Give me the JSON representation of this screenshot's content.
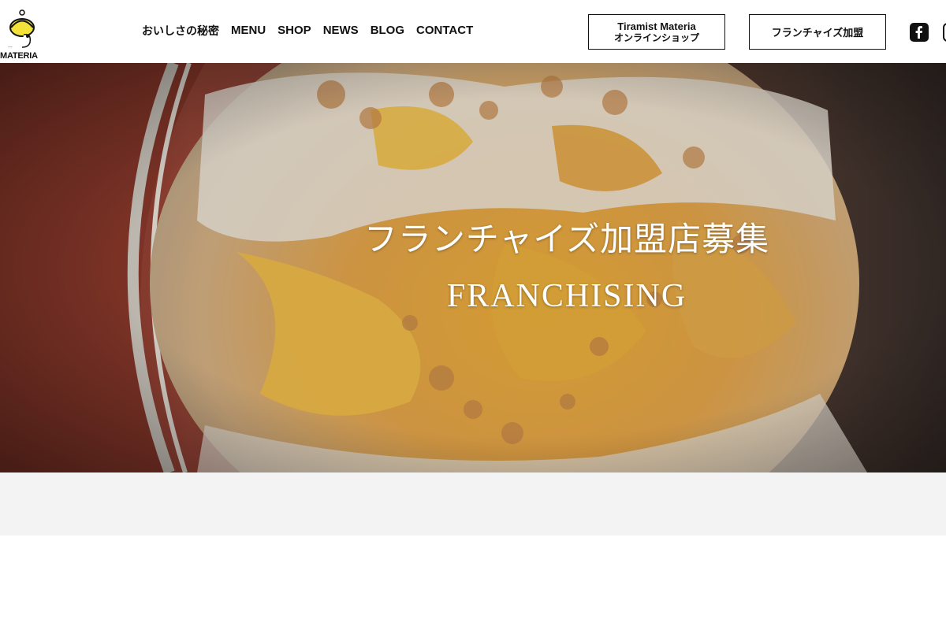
{
  "logo": {
    "text": "MATERIA",
    "colors": {
      "yellow": "#f2e23a",
      "black": "#111111"
    }
  },
  "nav": {
    "items": [
      {
        "label": "おいしさの秘密"
      },
      {
        "label": "MENU"
      },
      {
        "label": "SHOP"
      },
      {
        "label": "NEWS"
      },
      {
        "label": "BLOG"
      },
      {
        "label": "CONTACT"
      }
    ]
  },
  "header_buttons": {
    "shop_line1": "Tiramist Materia",
    "shop_line2": "オンラインショップ",
    "franchise": "フランチャイズ加盟"
  },
  "social": {
    "icons": [
      "facebook-icon",
      "instagram-icon"
    ]
  },
  "hero": {
    "title": "フランチャイズ加盟店募集",
    "subtitle": "FRANCHISING"
  },
  "colors": {
    "band": "#f3f3f3",
    "text": "#111111",
    "hero_text": "#ffffff"
  }
}
